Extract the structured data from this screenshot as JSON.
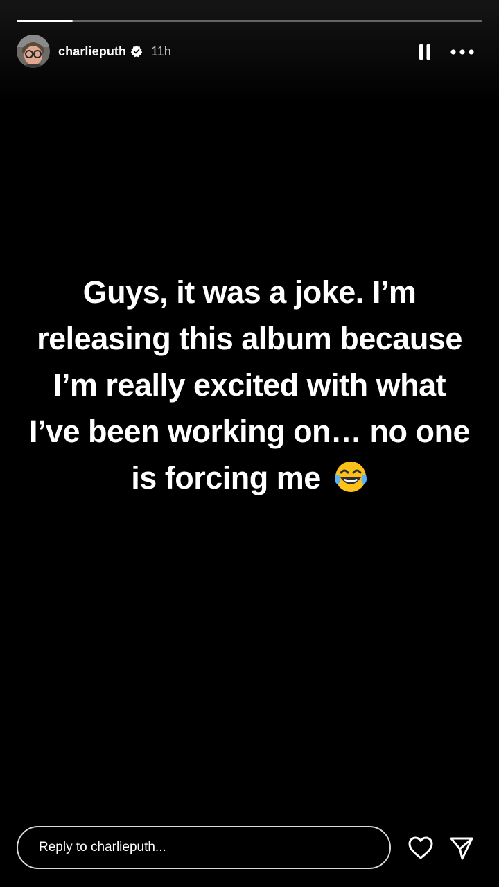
{
  "progress": {
    "fraction": 0.12
  },
  "header": {
    "username": "charlieputh",
    "verified": true,
    "time_ago": "11h",
    "avatar_icon": "profile-photo-avatar",
    "pause_icon": "pause-icon",
    "more_icon": "more-options-icon"
  },
  "story": {
    "text": "Guys, it was a joke. I’m releasing this album because I’m really excited with what I’ve been working on… no one is forcing me",
    "emoji": "face-with-tears-of-joy",
    "background_color": "#000000",
    "text_color": "#ffffff"
  },
  "footer": {
    "reply_placeholder": "Reply to charlieputh...",
    "like_icon": "heart-icon",
    "share_icon": "send-icon"
  }
}
